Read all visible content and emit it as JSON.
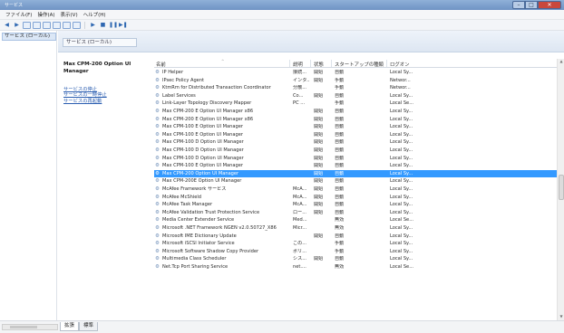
{
  "window": {
    "title": "サービス",
    "min": "–",
    "max": "□",
    "close": "✕"
  },
  "menu": [
    "ファイル(F)",
    "操作(A)",
    "表示(V)",
    "ヘルプ(H)"
  ],
  "toolbar": {
    "back": "◀",
    "forward": "▶",
    "play": "▶",
    "stop": "■",
    "pause": "❚❚",
    "restart": "▶❚"
  },
  "tree": {
    "node_label": "サービス (ローカル)"
  },
  "header": {
    "label": "サービス (ローカル)"
  },
  "description": {
    "service_title": "Max CPM-200 Option UI Manager",
    "links": [
      "サービスの停止",
      "サービスの一時停止",
      "サービスの再起動"
    ]
  },
  "table": {
    "columns": [
      "名前",
      "説明",
      "状態",
      "スタートアップの種類",
      "ログオン"
    ],
    "rows": [
      {
        "name": "IP Helper",
        "desc": "接続...",
        "status": "開始",
        "startup": "自動",
        "logon": "Local Sy..."
      },
      {
        "name": "IPsec Policy Agent",
        "desc": "インタ...",
        "status": "開始",
        "startup": "手動",
        "logon": "Networ..."
      },
      {
        "name": "KtmRm for Distributed Transaction Coordinator",
        "desc": "分散...",
        "status": "",
        "startup": "手動",
        "logon": "Networ..."
      },
      {
        "name": "Label Services",
        "desc": "Co...",
        "status": "開始",
        "startup": "自動",
        "logon": "Local Sy..."
      },
      {
        "name": "Link-Layer Topology Discovery Mapper",
        "desc": "PC ...",
        "status": "",
        "startup": "手動",
        "logon": "Local Se..."
      },
      {
        "name": "Max CPM-200 E Option UI Manager x86",
        "desc": "",
        "status": "開始",
        "startup": "自動",
        "logon": "Local Sy..."
      },
      {
        "name": "Max CPM-200 E Option UI Manager x86",
        "desc": "",
        "status": "開始",
        "startup": "自動",
        "logon": "Local Sy..."
      },
      {
        "name": "Max CPM-100 E Option UI Manager",
        "desc": "",
        "status": "開始",
        "startup": "自動",
        "logon": "Local Sy..."
      },
      {
        "name": "Max CPM-100 E Option UI Manager",
        "desc": "",
        "status": "開始",
        "startup": "自動",
        "logon": "Local Sy..."
      },
      {
        "name": "Max CPM-100 D Option UI Manager",
        "desc": "",
        "status": "開始",
        "startup": "自動",
        "logon": "Local Sy..."
      },
      {
        "name": "Max CPM-100 D Option UI Manager",
        "desc": "",
        "status": "開始",
        "startup": "自動",
        "logon": "Local Sy..."
      },
      {
        "name": "Max CPM-100 D Option UI Manager",
        "desc": "",
        "status": "開始",
        "startup": "自動",
        "logon": "Local Sy..."
      },
      {
        "name": "Max CPM-100 E Option UI Manager",
        "desc": "",
        "status": "開始",
        "startup": "自動",
        "logon": "Local Sy..."
      },
      {
        "name": "Max CPM-200 Option UI Manager",
        "desc": "",
        "status": "開始",
        "startup": "自動",
        "logon": "Local Sy...",
        "selected": true
      },
      {
        "name": "Max CPM-200E Option UI Manager",
        "desc": "",
        "status": "開始",
        "startup": "自動",
        "logon": "Local Sy..."
      },
      {
        "name": "McAfee Framework サービス",
        "desc": "McA...",
        "status": "開始",
        "startup": "自動",
        "logon": "Local Sy..."
      },
      {
        "name": "McAfee McShield",
        "desc": "McA...",
        "status": "開始",
        "startup": "自動",
        "logon": "Local Sy..."
      },
      {
        "name": "McAfee Task Manager",
        "desc": "McA...",
        "status": "開始",
        "startup": "自動",
        "logon": "Local Sy..."
      },
      {
        "name": "McAfee Validation Trust Protection Service",
        "desc": "ロー...",
        "status": "開始",
        "startup": "自動",
        "logon": "Local Sy..."
      },
      {
        "name": "Media Center Extender Service",
        "desc": "Med...",
        "status": "",
        "startup": "無効",
        "logon": "Local Se..."
      },
      {
        "name": "Microsoft .NET Framework NGEN v2.0.50727_X86",
        "desc": "Micr...",
        "status": "",
        "startup": "無効",
        "logon": "Local Sy..."
      },
      {
        "name": "Microsoft IME Dictionary Update",
        "desc": "",
        "status": "開始",
        "startup": "自動",
        "logon": "Local Sy..."
      },
      {
        "name": "Microsoft iSCSI Initiator Service",
        "desc": "この...",
        "status": "",
        "startup": "手動",
        "logon": "Local Sy..."
      },
      {
        "name": "Microsoft Software Shadow Copy Provider",
        "desc": "ボリ...",
        "status": "",
        "startup": "手動",
        "logon": "Local Sy..."
      },
      {
        "name": "Multimedia Class Scheduler",
        "desc": "シス...",
        "status": "開始",
        "startup": "自動",
        "logon": "Local Sy..."
      },
      {
        "name": "Net.Tcp Port Sharing Service",
        "desc": "net....",
        "status": "",
        "startup": "無効",
        "logon": "Local Se..."
      }
    ]
  },
  "tabs": [
    "拡張",
    "標準"
  ],
  "colors": {
    "selection": "#3399ff",
    "link": "#2a5db0"
  }
}
